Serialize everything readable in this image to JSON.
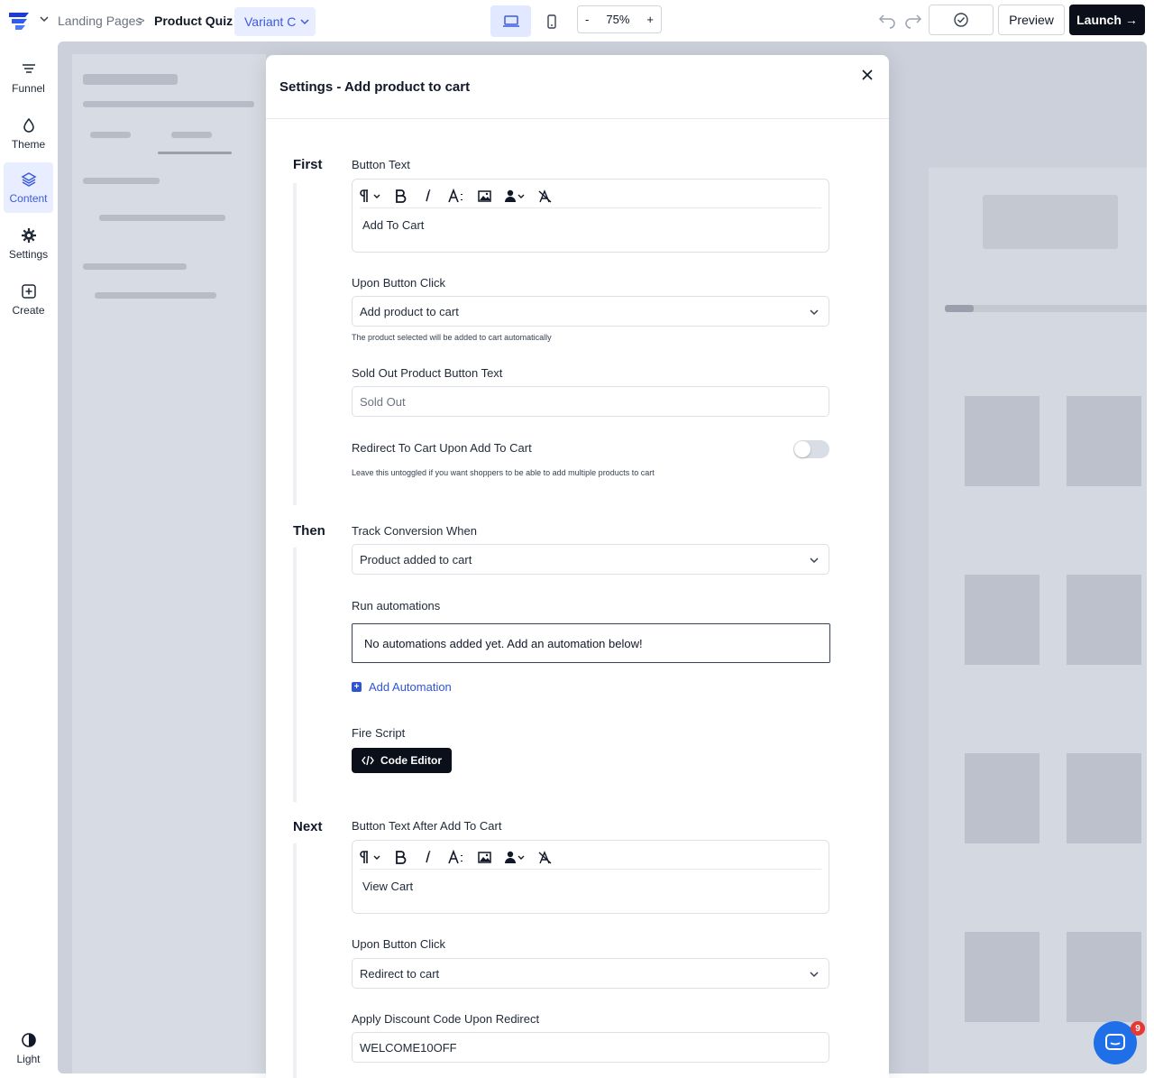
{
  "header": {
    "breadcrumb": [
      "Landing Pages",
      ">",
      "Product Quiz"
    ],
    "variant_label": "Variant C",
    "zoom_minus": "-",
    "zoom_level": "75%",
    "zoom_plus": "+",
    "preview_label": "Preview",
    "launch_label": "Launch",
    "launch_arrow": "→"
  },
  "sidebar": {
    "items": [
      {
        "label": "Funnel",
        "icon": "funnel-icon"
      },
      {
        "label": "Theme",
        "icon": "droplet-icon"
      },
      {
        "label": "Content",
        "icon": "layers-icon",
        "active": true
      },
      {
        "label": "Settings",
        "icon": "gear-icon"
      },
      {
        "label": "Create",
        "icon": "plus-square-icon"
      }
    ],
    "theme_toggle_label": "Light"
  },
  "modal": {
    "title": "Settings - Add product to cart",
    "first": {
      "label": "First",
      "button_text_label": "Button Text",
      "button_text_value": "Add To Cart",
      "upon_click_label": "Upon Button Click",
      "upon_click_value": "Add product to cart",
      "upon_click_hint": "The product selected will be added to cart automatically",
      "sold_out_label": "Sold Out Product Button Text",
      "sold_out_placeholder": "Sold Out",
      "redirect_label": "Redirect To Cart Upon Add To Cart",
      "redirect_hint": "Leave this untoggled if you want shoppers to be able to add multiple products to cart",
      "redirect_enabled": false
    },
    "then": {
      "label": "Then",
      "track_label": "Track Conversion When",
      "track_value": "Product added to cart",
      "automations_label": "Run automations",
      "automations_empty": "No automations added yet. Add an automation below!",
      "add_automation_label": "Add Automation",
      "fire_script_label": "Fire Script",
      "code_editor_label": "Code Editor"
    },
    "next": {
      "label": "Next",
      "button_text_after_label": "Button Text After Add To Cart",
      "button_text_after_value": "View Cart",
      "upon_click_label": "Upon Button Click",
      "upon_click_value": "Redirect to cart",
      "discount_label": "Apply Discount Code Upon Redirect",
      "discount_value": "WELCOME10OFF"
    }
  },
  "chat": {
    "badge_count": "9"
  },
  "colors": {
    "accent": "#3b5bdb",
    "dark": "#0b0f19",
    "link": "#2f55d4",
    "chat": "#1e6fe8",
    "badge": "#e53935"
  }
}
